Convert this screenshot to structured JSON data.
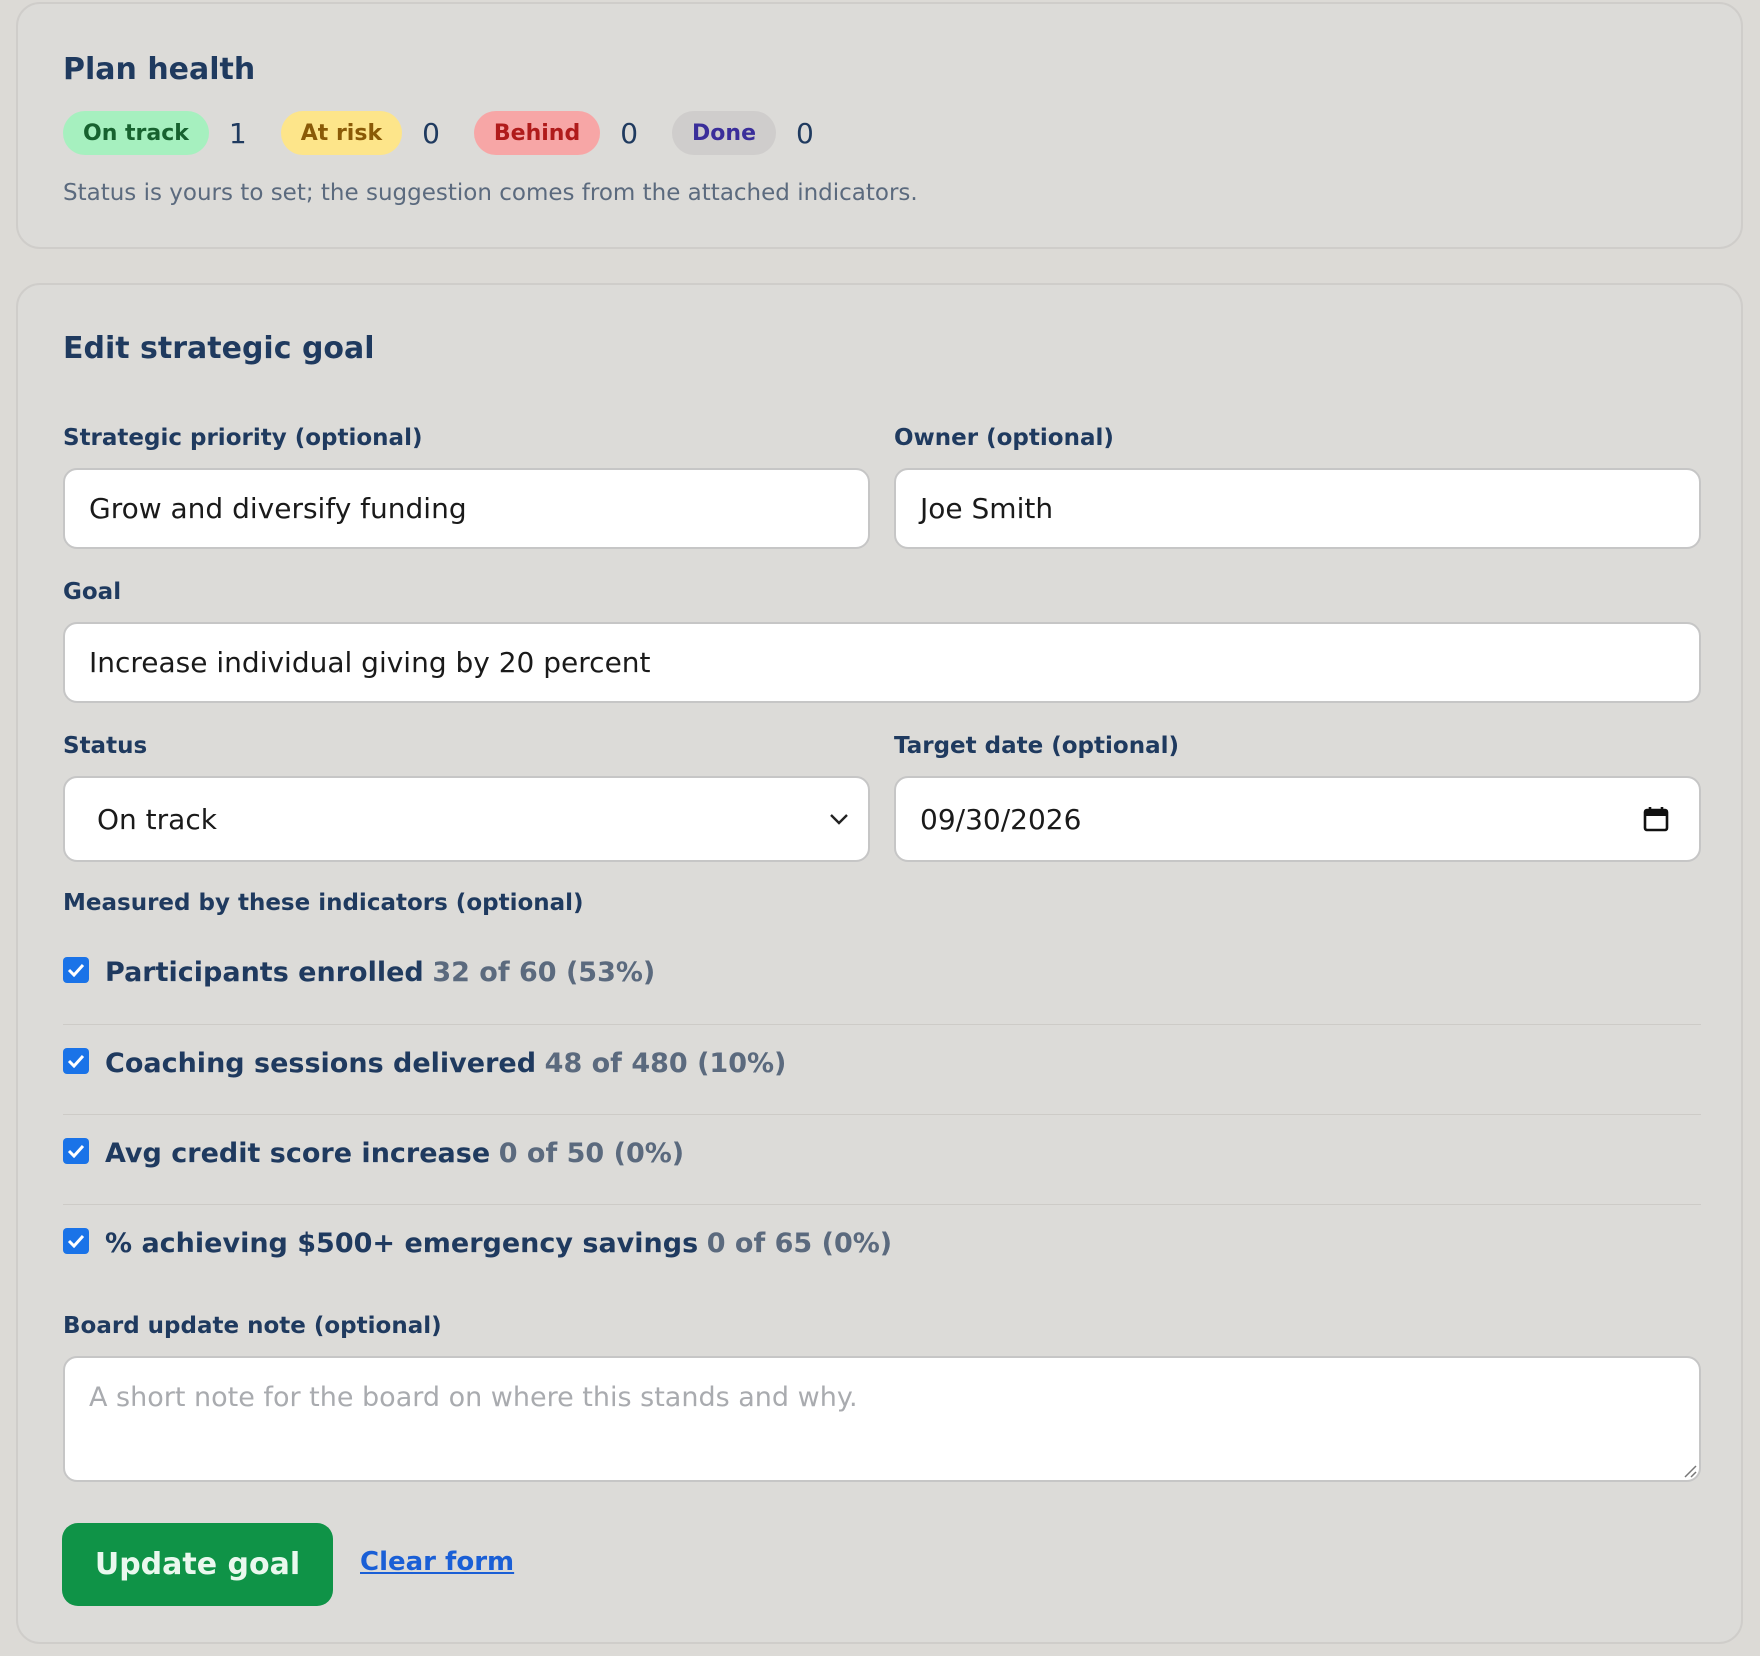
{
  "plan_health": {
    "title": "Plan health",
    "statuses": [
      {
        "label": "On track",
        "count": "1",
        "bg": "#a6f0bf",
        "fg": "#17622f"
      },
      {
        "label": "At risk",
        "count": "0",
        "bg": "#fde58a",
        "fg": "#8a5a07"
      },
      {
        "label": "Behind",
        "count": "0",
        "bg": "#f7a6a6",
        "fg": "#b01b1b"
      },
      {
        "label": "Done",
        "count": "0",
        "bg": "#cfcdcc",
        "fg": "#3a2e9a"
      }
    ],
    "hint": "Status is yours to set; the suggestion comes from the attached indicators."
  },
  "edit_goal": {
    "title": "Edit strategic goal",
    "priority_label": "Strategic priority (optional)",
    "priority_value": "Grow and diversify funding",
    "owner_label": "Owner (optional)",
    "owner_value": "Joe Smith",
    "goal_label": "Goal",
    "goal_value": "Increase individual giving by 20 percent",
    "status_label": "Status",
    "status_value": "On track",
    "target_label": "Target date (optional)",
    "target_value": "09/30/2026",
    "indicators_label": "Measured by these indicators (optional)",
    "indicators": [
      {
        "name": "Participants enrolled",
        "value": "32 of 60 (53%)",
        "checked": true
      },
      {
        "name": "Coaching sessions delivered",
        "value": "48 of 480 (10%)",
        "checked": true
      },
      {
        "name": "Avg credit score increase",
        "value": "0 of 50 (0%)",
        "checked": true
      },
      {
        "name": "% achieving $500+ emergency savings",
        "value": "0 of 65 (0%)",
        "checked": true
      }
    ],
    "note_label": "Board update note (optional)",
    "note_placeholder": "A short note for the board on where this stands and why.",
    "update_button": "Update goal",
    "clear_link": "Clear form"
  },
  "colors": {
    "accent_green": "#0f9347",
    "link_blue": "#1a5fd6",
    "checkbox_blue": "#1a73e8",
    "heading_navy": "#1f3a5f"
  }
}
